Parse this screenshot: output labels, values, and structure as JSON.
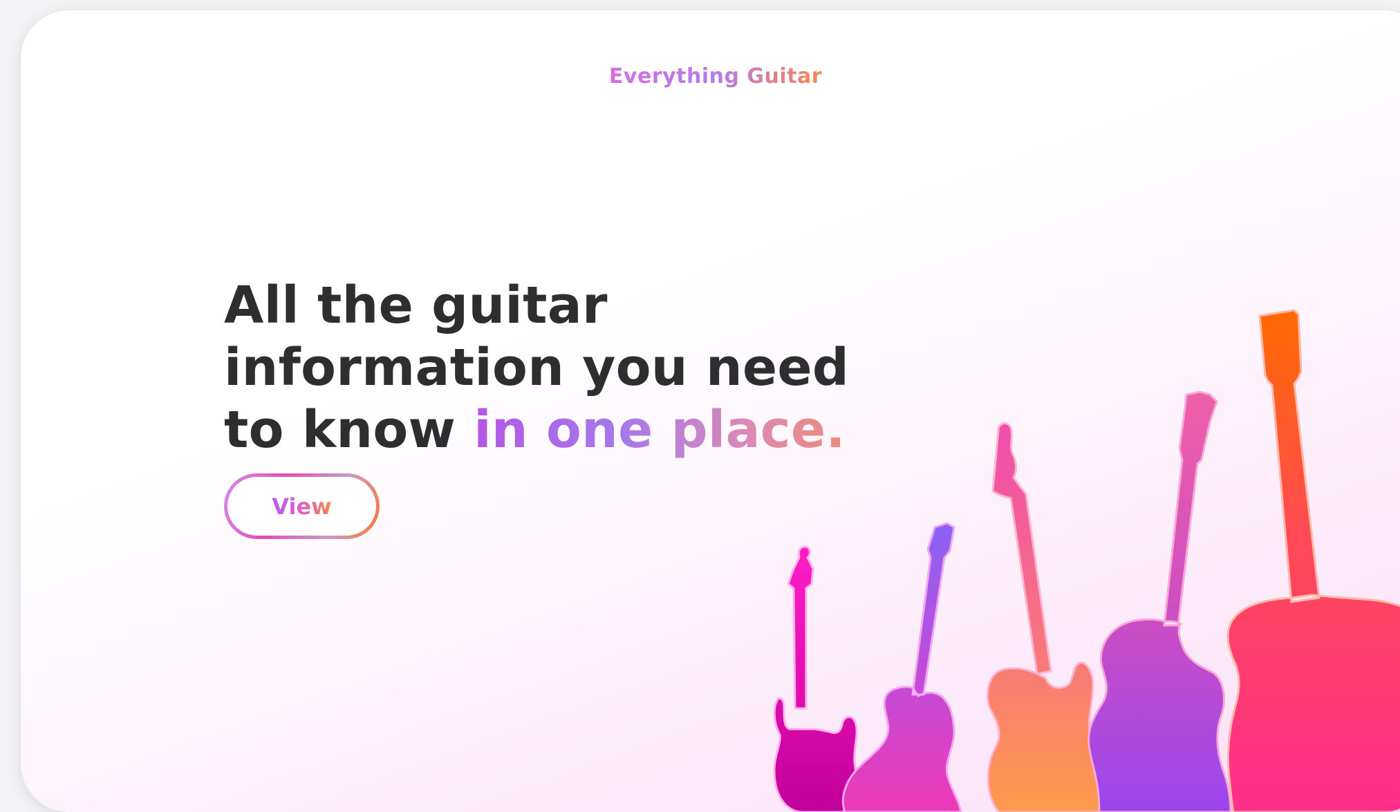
{
  "brand": {
    "title": "Everything Guitar"
  },
  "hero": {
    "headline_line1": "All the guitar",
    "headline_line2": "information you need",
    "headline_line3_prefix": "to know ",
    "headline_line3_accent": "in one place."
  },
  "cta": {
    "view_label": "View"
  },
  "colors": {
    "text_dark": "#2e2e30",
    "accent_pink": "#e034c4",
    "accent_purple": "#9a5cf0",
    "accent_orange": "#ff6a00",
    "accent_coral": "#f77a6c"
  },
  "illustration": {
    "icons": [
      "electric-guitar-icon",
      "acoustic-guitar-icon",
      "telecaster-guitar-icon",
      "semi-hollow-guitar-icon",
      "dreadnought-guitar-icon"
    ]
  }
}
